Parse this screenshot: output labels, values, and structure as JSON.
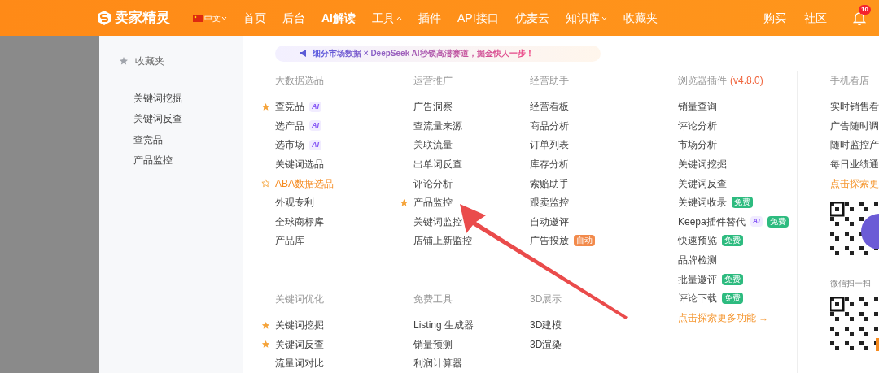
{
  "topbar": {
    "brand": "卖家精灵",
    "language": {
      "label": "中文",
      "expanded": false
    },
    "nav": [
      {
        "label": "首页"
      },
      {
        "label": "后台"
      },
      {
        "label": "AI解读"
      },
      {
        "label": "工具",
        "expanded": true
      },
      {
        "label": "插件"
      },
      {
        "label": "API接口"
      },
      {
        "label": "优麦云"
      },
      {
        "label": "知识库",
        "expanded": false
      },
      {
        "label": "收藏夹"
      }
    ],
    "right": [
      {
        "label": "购买"
      },
      {
        "label": "社区"
      }
    ],
    "notifications": "10"
  },
  "favorites": {
    "title": "收藏夹",
    "items": [
      "关键词挖掘",
      "关键词反查",
      "查竞品",
      "产品监控"
    ]
  },
  "banner": {
    "text": "细分市场数据 × DeepSeek AI秒锁高潜赛道，掘金快人一步！"
  },
  "columns": [
    {
      "sections": [
        {
          "title": "大数据选品",
          "items": [
            {
              "label": "查竞品",
              "starred": true,
              "badges": [
                {
                  "kind": "ai",
                  "text": "AI"
                }
              ]
            },
            {
              "label": "选产品",
              "badges": [
                {
                  "kind": "ai",
                  "text": "AI"
                }
              ]
            },
            {
              "label": "选市场",
              "badges": [
                {
                  "kind": "ai",
                  "text": "AI"
                }
              ]
            },
            {
              "label": "关键词选品"
            },
            {
              "label": "ABA数据选品",
              "starred": false,
              "highlighted": true
            },
            {
              "label": "外观专利"
            },
            {
              "label": "全球商标库"
            },
            {
              "label": "产品库"
            }
          ]
        },
        {
          "title": "关键词优化",
          "items": [
            {
              "label": "关键词挖掘",
              "starred": true
            },
            {
              "label": "关键词反查",
              "starred": true
            },
            {
              "label": "流量词对比"
            }
          ]
        }
      ]
    },
    {
      "sections": [
        {
          "title": "运营推广",
          "items": [
            {
              "label": "广告洞察"
            },
            {
              "label": "查流量来源"
            },
            {
              "label": "关联流量"
            },
            {
              "label": "出单词反查"
            },
            {
              "label": "评论分析"
            },
            {
              "label": "产品监控",
              "starred": true
            },
            {
              "label": "关键词监控"
            },
            {
              "label": "店铺上新监控"
            }
          ]
        },
        {
          "title": "免费工具",
          "items": [
            {
              "label": "Listing 生成器"
            },
            {
              "label": "销量预测"
            },
            {
              "label": "利润计算器"
            }
          ]
        }
      ]
    },
    {
      "sections": [
        {
          "title": "经营助手",
          "items": [
            {
              "label": "经营看板"
            },
            {
              "label": "商品分析"
            },
            {
              "label": "订单列表"
            },
            {
              "label": "库存分析"
            },
            {
              "label": "索赔助手"
            },
            {
              "label": "跟卖监控"
            },
            {
              "label": "自动邀评"
            },
            {
              "label": "广告投放",
              "badges": [
                {
                  "kind": "auto",
                  "text": "自动"
                }
              ]
            }
          ]
        },
        {
          "title": "3D展示",
          "items": [
            {
              "label": "3D建模"
            },
            {
              "label": "3D渲染"
            }
          ]
        }
      ]
    },
    {
      "sections": [
        {
          "title": "浏览器插件",
          "version": "(v4.8.0)",
          "items": [
            {
              "label": "销量查询"
            },
            {
              "label": "评论分析"
            },
            {
              "label": "市场分析"
            },
            {
              "label": "关键词挖掘"
            },
            {
              "label": "关键词反查"
            },
            {
              "label": "关键词收录",
              "badges": [
                {
                  "kind": "free",
                  "text": "免费"
                }
              ]
            },
            {
              "label": "Keepa插件替代",
              "badges": [
                {
                  "kind": "ai",
                  "text": "AI"
                },
                {
                  "kind": "free",
                  "text": "免费"
                }
              ]
            },
            {
              "label": "快速预览",
              "badges": [
                {
                  "kind": "free",
                  "text": "免费"
                }
              ]
            },
            {
              "label": "品牌检测"
            },
            {
              "label": "批量邀评",
              "badges": [
                {
                  "kind": "free",
                  "text": "免费"
                }
              ]
            },
            {
              "label": "评论下载",
              "badges": [
                {
                  "kind": "free",
                  "text": "免费"
                }
              ]
            }
          ],
          "more": "点击探索更多功能 →"
        }
      ]
    },
    {
      "sections": [
        {
          "title": "手机看店",
          "items": [
            {
              "label": "实时销售看"
            },
            {
              "label": "广告随时调"
            },
            {
              "label": "随时监控产"
            },
            {
              "label": "每日业绩通"
            }
          ],
          "more": "点击探索更",
          "qr_caption": "微信扫一扫"
        }
      ]
    }
  ]
}
